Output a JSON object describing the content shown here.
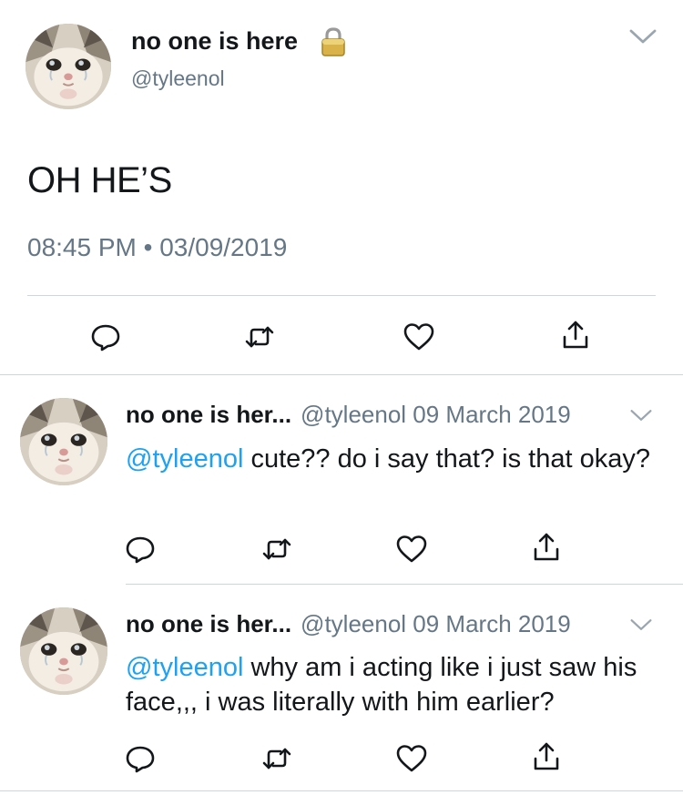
{
  "main_tweet": {
    "display_name": "no one is here",
    "handle": "@tyleenol",
    "protected_icon": "lock-icon",
    "text": "OH HE’S",
    "timestamp": "08:45 PM • 03/09/2019",
    "actions": [
      "reply-icon",
      "retweet-icon",
      "like-icon",
      "share-icon"
    ]
  },
  "replies": [
    {
      "display_name": "no one is her...",
      "meta": "@tyleenol 09 March 2019",
      "mention": "@tyleenol",
      "text": " cute?? do i say that? is that okay?"
    },
    {
      "display_name": "no one is her...",
      "meta": "@tyleenol 09 March 2019",
      "mention": "@tyleenol",
      "text": " why am i acting like i just saw his face,,, i was literally with him earlier?"
    }
  ],
  "colors": {
    "text": "#14171a",
    "secondary": "#657786",
    "link": "#1da1f2",
    "divider": "#ccd6dd"
  }
}
